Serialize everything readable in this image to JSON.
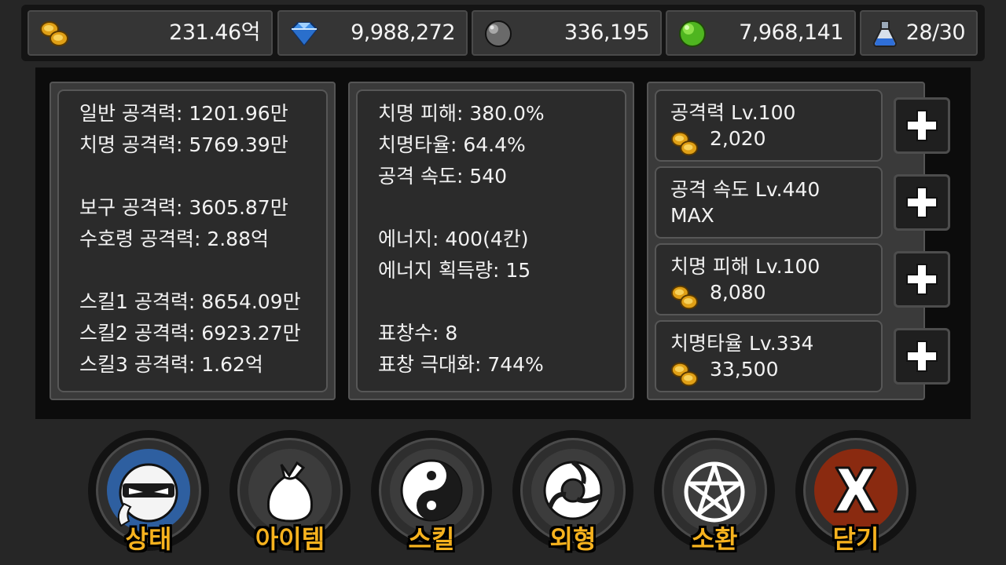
{
  "currencies": [
    {
      "icon": "gold-coins-icon",
      "value": "231.46억"
    },
    {
      "icon": "diamond-icon",
      "value": "9,988,272"
    },
    {
      "icon": "stone-orb-icon",
      "value": "336,195"
    },
    {
      "icon": "green-gem-icon",
      "value": "7,968,141"
    },
    {
      "icon": "potion-icon",
      "value": "28/30"
    }
  ],
  "stats_left": [
    "일반 공격력: 1201.96만",
    "치명 공격력: 5769.39만",
    "보구 공격력: 3605.87만",
    "수호령 공격력: 2.88억",
    "스킬1 공격력: 8654.09만",
    "스킬2 공격력: 6923.27만",
    "스킬3 공격력: 1.62억"
  ],
  "stats_mid": [
    "치명 피해: 380.0%",
    "치명타율: 64.4%",
    "공격 속도: 540",
    "에너지: 400(4칸)",
    "에너지 획득량: 15",
    "표창수: 8",
    "표창 극대화: 744%"
  ],
  "upgrades": [
    {
      "name": "공격력 Lv.100",
      "cost": "2,020",
      "max": ""
    },
    {
      "name": "공격 속도 Lv.440",
      "cost": "",
      "max": "MAX"
    },
    {
      "name": "치명 피해 Lv.100",
      "cost": "8,080",
      "max": ""
    },
    {
      "name": "치명타율 Lv.334",
      "cost": "33,500",
      "max": ""
    }
  ],
  "nav": [
    {
      "label": "상태",
      "icon": "ninja-face-icon"
    },
    {
      "label": "아이템",
      "icon": "bag-icon"
    },
    {
      "label": "스킬",
      "icon": "yin-yang-icon"
    },
    {
      "label": "외형",
      "icon": "shuriken-icon"
    },
    {
      "label": "소환",
      "icon": "pentagram-icon"
    },
    {
      "label": "닫기",
      "icon": "close-x-icon"
    }
  ],
  "colors": {
    "label_gold": "#f6b21e",
    "status_button_blue": "#2e5fa0",
    "close_button_red": "#8a2a10"
  }
}
